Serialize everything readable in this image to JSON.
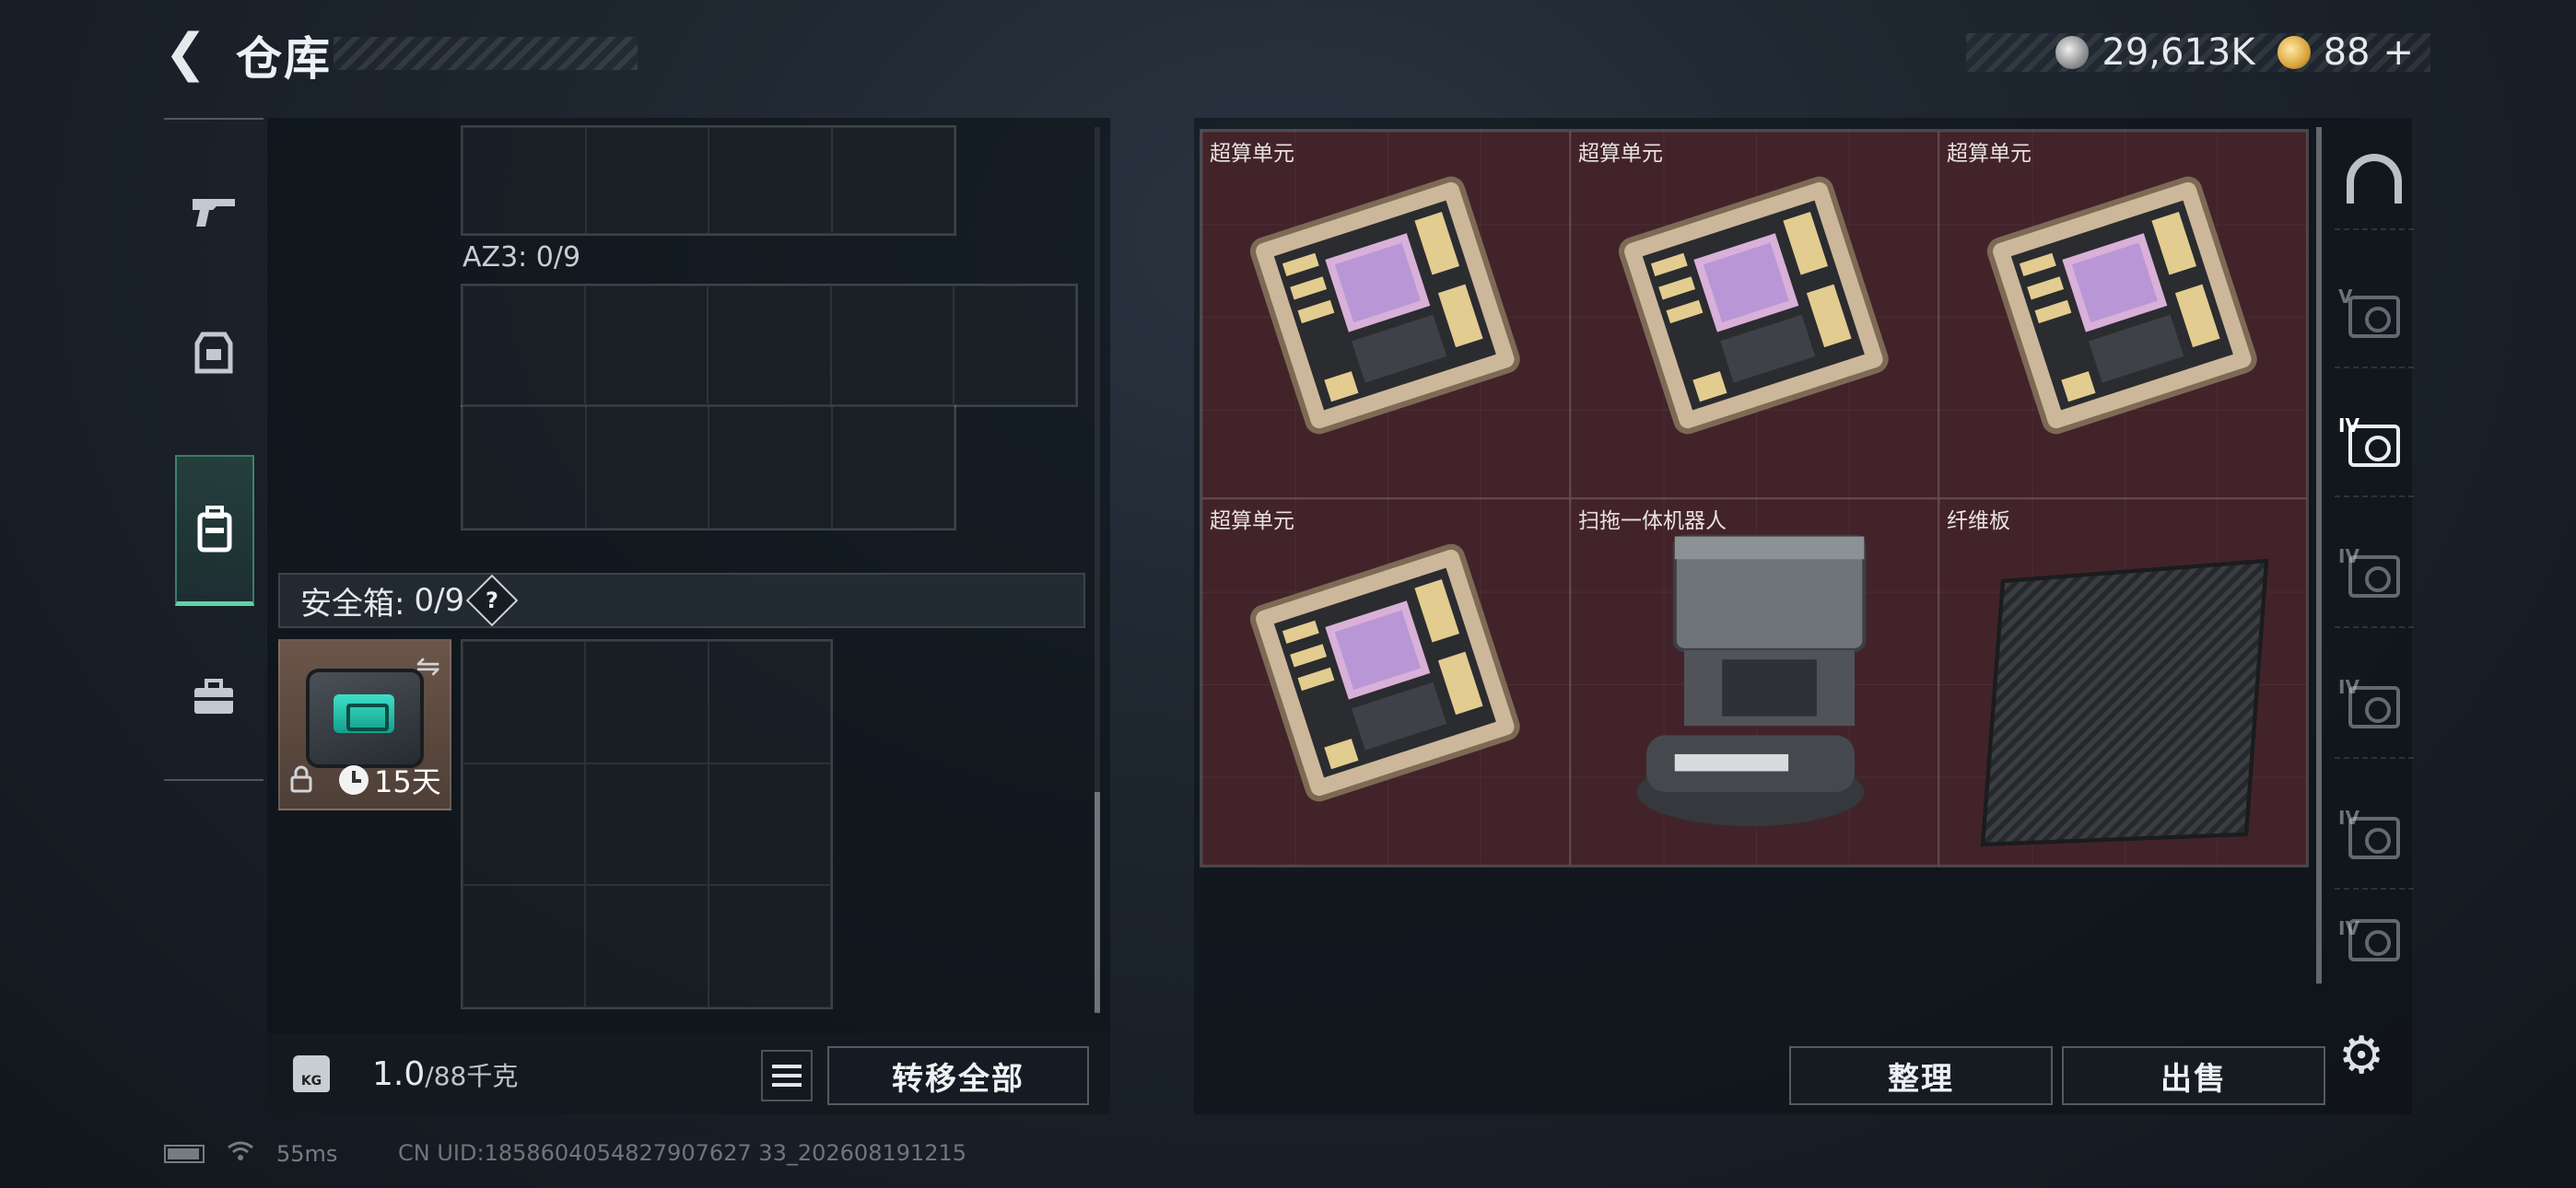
{
  "header": {
    "title": "仓库",
    "currency_silver": "29,613K",
    "currency_gold": "88",
    "add_label": "+"
  },
  "left_panel": {
    "container_label": "AZ3: 0/9",
    "safe_box_label": "安全箱:",
    "safe_box_count": "0/9",
    "help_label": "?",
    "safe_item_timer": "15天",
    "weight_value": "1.0",
    "weight_capacity": "/88千克",
    "kg_label": "KG",
    "transfer_all_label": "转移全部"
  },
  "stash": {
    "items": [
      {
        "name": "超算单元",
        "icon": "circuit-board"
      },
      {
        "name": "超算单元",
        "icon": "circuit-board"
      },
      {
        "name": "超算单元",
        "icon": "circuit-board"
      },
      {
        "name": "超算单元",
        "icon": "circuit-board"
      },
      {
        "name": "扫拖一体机器人",
        "icon": "robot-vacuum"
      },
      {
        "name": "纤维板",
        "icon": "fiber-board"
      }
    ],
    "item_background": "#43232a",
    "sort_label": "整理",
    "sell_label": "出售"
  },
  "tabs": {
    "levels": [
      "V",
      "IV",
      "IV",
      "IV",
      "IV",
      "IV"
    ]
  },
  "status": {
    "ping": "55ms",
    "uid": "CN UID:1858604054827907627 33_202608191215"
  },
  "colors": {
    "accent_green": "#5fd3a5"
  }
}
